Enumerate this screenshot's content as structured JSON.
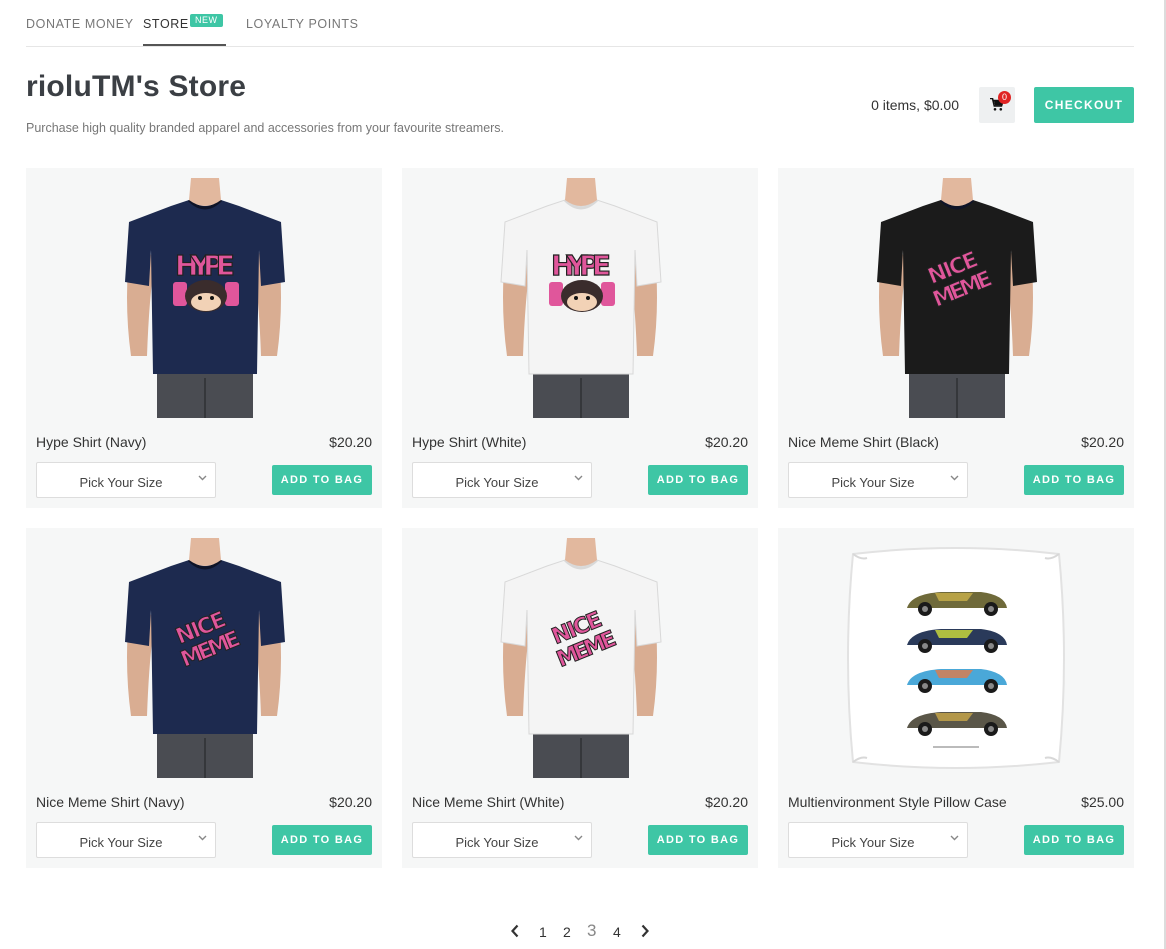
{
  "tabs": [
    {
      "label": "DONATE MONEY"
    },
    {
      "label": "STORE",
      "badge": "NEW"
    },
    {
      "label": "LOYALTY POINTS"
    }
  ],
  "store": {
    "title": "rioluTM's Store",
    "subtitle": "Purchase high quality branded apparel and accessories from your favourite streamers."
  },
  "cart": {
    "summary": "0 items, $0.00",
    "count": "0",
    "checkout_label": "CHECKOUT"
  },
  "products": [
    {
      "name": "Hype Shirt (Navy)",
      "price": "$20.20",
      "size_placeholder": "Pick Your Size",
      "add_label": "ADD TO BAG",
      "shirt_color": "#1d2a4f",
      "print": "HYPE"
    },
    {
      "name": "Hype Shirt (White)",
      "price": "$20.20",
      "size_placeholder": "Pick Your Size",
      "add_label": "ADD TO BAG",
      "shirt_color": "#f4f4f4",
      "print": "HYPE"
    },
    {
      "name": "Nice Meme Shirt (Black)",
      "price": "$20.20",
      "size_placeholder": "Pick Your Size",
      "add_label": "ADD TO BAG",
      "shirt_color": "#1b1b1b",
      "print": "NICE MEME"
    },
    {
      "name": "Nice Meme Shirt (Navy)",
      "price": "$20.20",
      "size_placeholder": "Pick Your Size",
      "add_label": "ADD TO BAG",
      "shirt_color": "#1d2a4f",
      "print": "NICE MEME"
    },
    {
      "name": "Nice Meme Shirt (White)",
      "price": "$20.20",
      "size_placeholder": "Pick Your Size",
      "add_label": "ADD TO BAG",
      "shirt_color": "#f4f4f4",
      "print": "NICE MEME"
    },
    {
      "name": "Multienvironment Style Pillow Case",
      "price": "$25.00",
      "size_placeholder": "Pick Your Size",
      "add_label": "ADD TO BAG",
      "shirt_color": "#ffffff",
      "print": "PILLOW"
    }
  ],
  "pagination": {
    "pages": [
      "1",
      "2",
      "3",
      "4"
    ],
    "current": "3"
  },
  "colors": {
    "accent": "#3ec6a5",
    "cart_badge": "#e02424",
    "print_pink": "#e0569b"
  }
}
